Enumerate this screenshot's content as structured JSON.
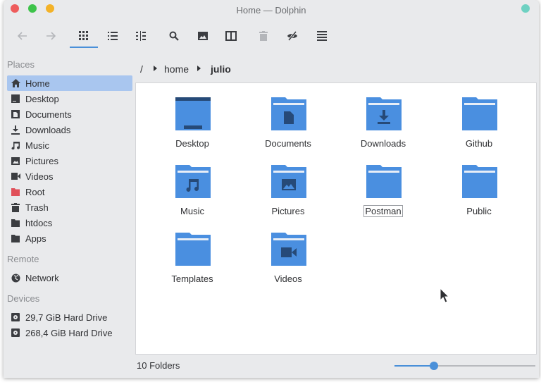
{
  "window": {
    "title": "Home — Dolphin"
  },
  "toolbar": {
    "items": [
      {
        "name": "back-button",
        "icon": "arrow-left-icon"
      },
      {
        "name": "forward-button",
        "icon": "arrow-right-icon"
      },
      {
        "name": "icons-view-button",
        "icon": "grid-icon"
      },
      {
        "name": "compact-view-button",
        "icon": "list-icon"
      },
      {
        "name": "details-view-button",
        "icon": "columns-icon"
      },
      {
        "name": "search-button",
        "icon": "search-icon"
      },
      {
        "name": "preview-button",
        "icon": "image-icon"
      },
      {
        "name": "split-button",
        "icon": "split-icon"
      },
      {
        "name": "trash-button",
        "icon": "trash-icon"
      },
      {
        "name": "hidden-files-button",
        "icon": "eye-off-icon"
      },
      {
        "name": "menu-button",
        "icon": "menu-icon"
      }
    ]
  },
  "sidebar": {
    "places_title": "Places",
    "places": [
      {
        "label": "Home",
        "icon": "home-icon"
      },
      {
        "label": "Desktop",
        "icon": "desktop-icon"
      },
      {
        "label": "Documents",
        "icon": "document-icon"
      },
      {
        "label": "Downloads",
        "icon": "download-icon"
      },
      {
        "label": "Music",
        "icon": "music-icon"
      },
      {
        "label": "Pictures",
        "icon": "picture-icon"
      },
      {
        "label": "Videos",
        "icon": "video-icon"
      },
      {
        "label": "Root",
        "icon": "folder-red-icon"
      },
      {
        "label": "Trash",
        "icon": "trash-icon"
      },
      {
        "label": "htdocs",
        "icon": "folder-icon"
      },
      {
        "label": "Apps",
        "icon": "folder-icon"
      }
    ],
    "remote_title": "Remote",
    "remote": [
      {
        "label": "Network",
        "icon": "network-icon"
      }
    ],
    "devices_title": "Devices",
    "devices": [
      {
        "label": "29,7 GiB Hard Drive",
        "icon": "drive-icon"
      },
      {
        "label": "268,4 GiB Hard Drive",
        "icon": "drive-icon"
      }
    ]
  },
  "breadcrumb": {
    "root": "/",
    "parts": [
      "home",
      "julio"
    ]
  },
  "folders": [
    {
      "label": "Desktop",
      "icon": "desktop-folder-icon"
    },
    {
      "label": "Documents",
      "icon": "documents-folder-icon"
    },
    {
      "label": "Downloads",
      "icon": "downloads-folder-icon"
    },
    {
      "label": "Github",
      "icon": "folder-icon"
    },
    {
      "label": "Music",
      "icon": "music-folder-icon"
    },
    {
      "label": "Pictures",
      "icon": "pictures-folder-icon"
    },
    {
      "label": "Postman",
      "icon": "folder-icon"
    },
    {
      "label": "Public",
      "icon": "folder-icon"
    },
    {
      "label": "Templates",
      "icon": "folder-icon"
    },
    {
      "label": "Videos",
      "icon": "videos-folder-icon"
    }
  ],
  "status": {
    "text": "10 Folders",
    "zoom_fraction": 0.28
  },
  "colors": {
    "accent": "#4a90d9",
    "folder": "#4a8fe0",
    "folder_dark": "#264a78",
    "selection": "#a9c6ef"
  }
}
